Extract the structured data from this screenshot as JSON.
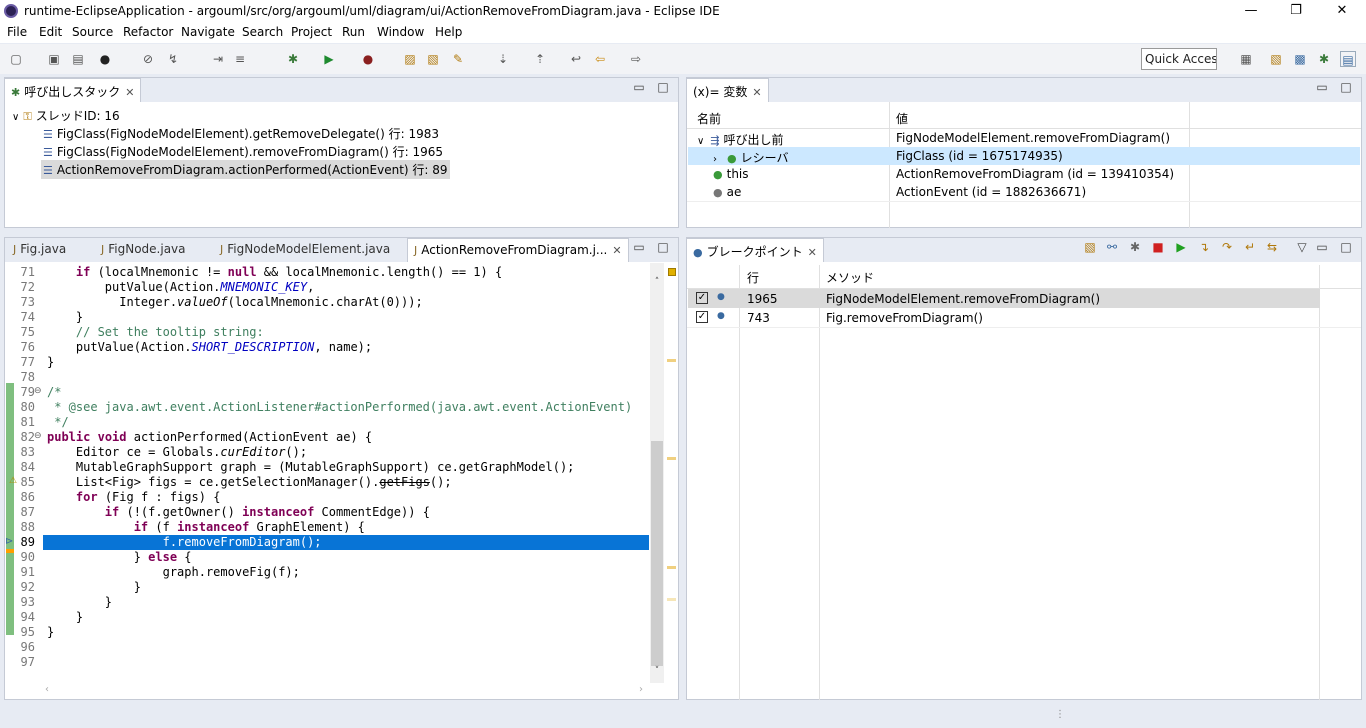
{
  "window": {
    "title": "runtime-EclipseApplication - argouml/src/org/argouml/uml/diagram/ui/ActionRemoveFromDiagram.java - Eclipse IDE",
    "min": "—",
    "restore": "❐",
    "close": "✕"
  },
  "menu": [
    "File",
    "Edit",
    "Source",
    "Refactor",
    "Navigate",
    "Search",
    "Project",
    "Run",
    "Window",
    "Help"
  ],
  "toolbar": {
    "quick_access": "Quick Access"
  },
  "callstack": {
    "tab": "呼び出しスタック",
    "thread": "スレッドID: 16",
    "frames": [
      "FigClass(FigNodeModelElement).getRemoveDelegate() 行: 1983",
      "FigClass(FigNodeModelElement).removeFromDiagram() 行: 1965",
      "ActionRemoveFromDiagram.actionPerformed(ActionEvent) 行: 89"
    ]
  },
  "variables": {
    "tab": "(x)= 変数",
    "col_name": "名前",
    "col_value": "値",
    "rows": [
      {
        "name": "呼び出し前",
        "value": "FigNodeModelElement.removeFromDiagram()"
      },
      {
        "name": "レシーバ",
        "value": "FigClass (id = 1675174935)"
      },
      {
        "name": "this",
        "value": "ActionRemoveFromDiagram (id = 139410354)"
      },
      {
        "name": "ae",
        "value": "ActionEvent (id = 1882636671)"
      }
    ]
  },
  "editor": {
    "tabs": [
      "Fig.java",
      "FigNode.java",
      "FigNodeModelElement.java",
      "ActionRemoveFromDiagram.j..."
    ],
    "lines": [
      "71",
      "72",
      "73",
      "74",
      "75",
      "76",
      "77",
      "78",
      "79",
      "80",
      "81",
      "82",
      "83",
      "84",
      "85",
      "86",
      "87",
      "88",
      "89",
      "90",
      "91",
      "92",
      "93",
      "94",
      "95",
      "96",
      "97"
    ]
  },
  "breakpoints": {
    "tab": "ブレークポイント",
    "col_line": "行",
    "col_method": "メソッド",
    "rows": [
      {
        "line": "1965",
        "method": "FigNodeModelElement.removeFromDiagram()"
      },
      {
        "line": "743",
        "method": "Fig.removeFromDiagram()"
      }
    ]
  },
  "colors": {
    "accent": "#0874d6",
    "keyword": "#7f0055",
    "string": "#2a00ff",
    "comment": "#3f7f5f",
    "field": "#0000c0"
  }
}
